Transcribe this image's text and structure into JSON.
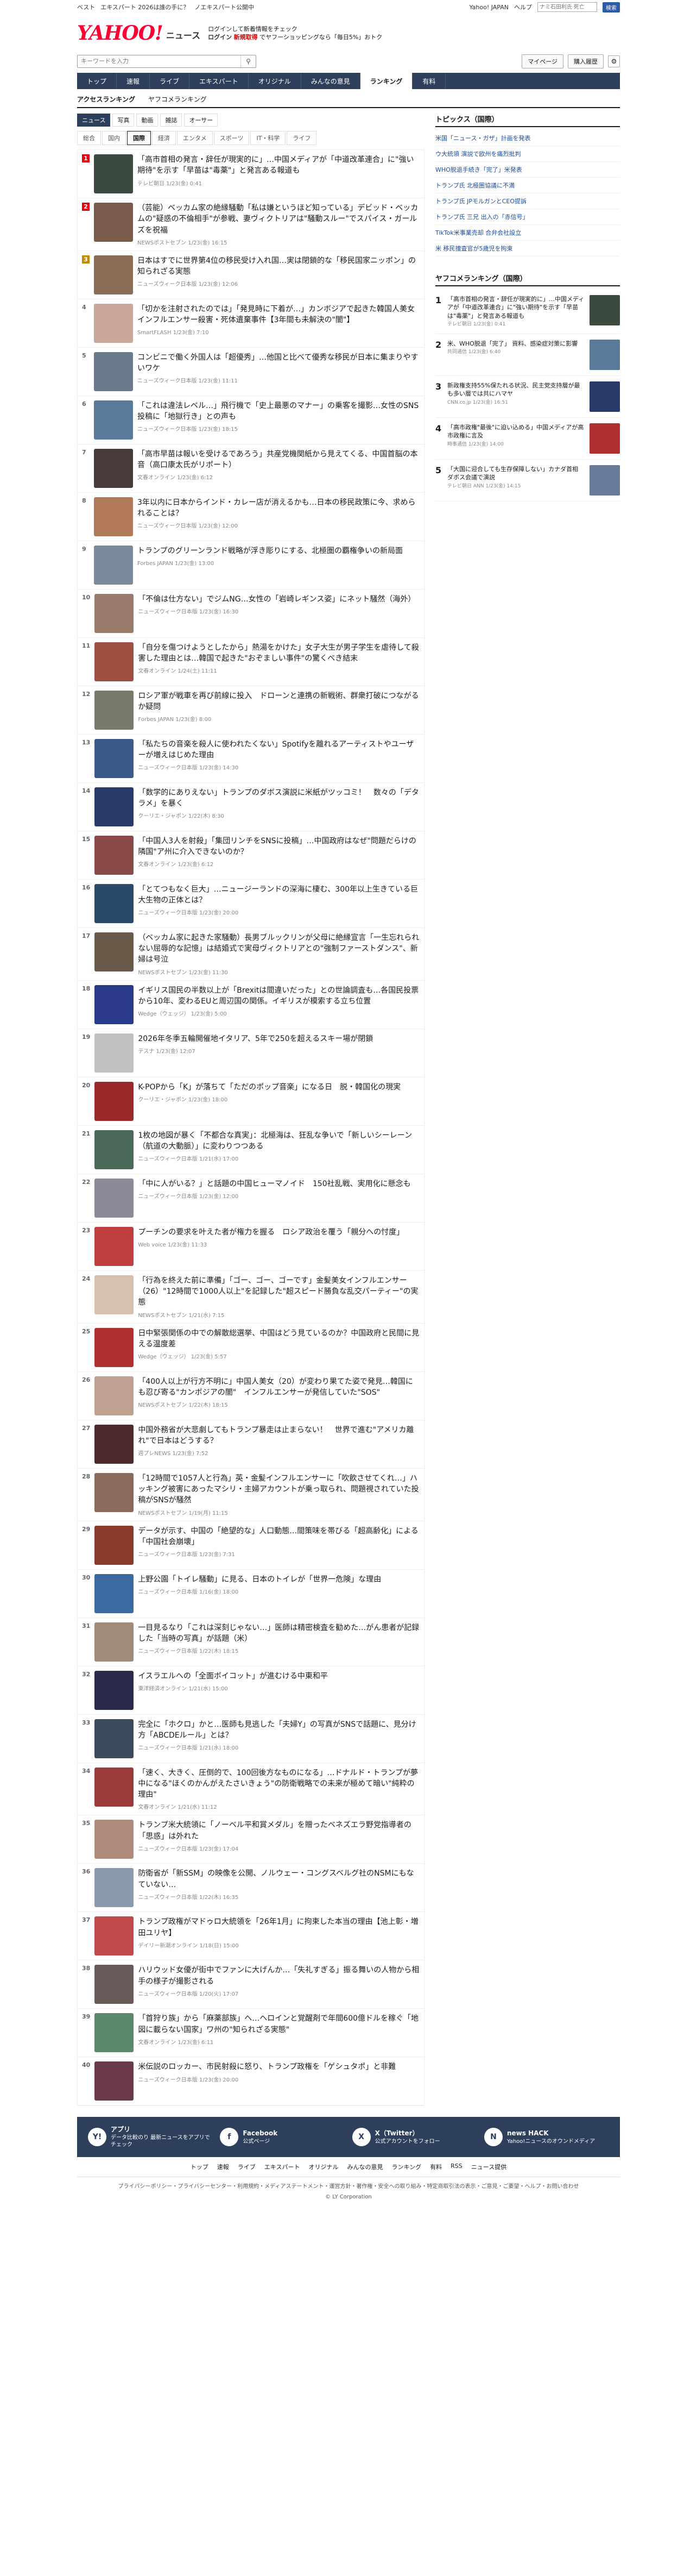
{
  "topstrip": {
    "left": [
      "ベスト",
      "エキスパート 2026は誰の手に？",
      "ノエキスパート公開中"
    ],
    "right_links": [
      "Yahoo! JAPAN",
      "ヘルプ"
    ],
    "search_placeholder": "ナミ石田利氏 死亡",
    "search_button": "検索"
  },
  "header": {
    "logo_text": "YAHOO!",
    "logo_sub": "JAPAN",
    "news_label": "ニュース",
    "promo_line1": "ログインして新着情報をチェック",
    "promo_line2": "お得なサービス",
    "login_label": "ログイン",
    "promo_red": "新規取得",
    "promo_line3": "でヤフーショッピングなら「毎日5%」おトク"
  },
  "search": {
    "placeholder": "キーワードを入力",
    "mypage": "マイページ",
    "register": "購入履歴"
  },
  "nav": [
    "トップ",
    "速報",
    "ライブ",
    "エキスパート",
    "オリジナル",
    "みんなの意見",
    "ランキング",
    "有料"
  ],
  "nav_active": 6,
  "ranking_tabs": [
    "アクセスランキング",
    "ヤフコメランキング"
  ],
  "subtabs": [
    "ニュース",
    "写真",
    "動画",
    "雑誌",
    "オーサー"
  ],
  "category_tabs": [
    "総合",
    "国内",
    "国際",
    "経済",
    "エンタメ",
    "スポーツ",
    "IT・科学",
    "ライフ"
  ],
  "category_active": 2,
  "articles": [
    {
      "rank": "1",
      "title": "「高市首相の発言・辞任が現実的に」…中国メディアが「中道改革連合」に\"強い期待\"を示す「早苗は\"毒薬\"」と発言ある報道も",
      "meta": "テレビ朝日 1/23(金) 0:41"
    },
    {
      "rank": "2",
      "title": "（芸能）ベッカム家の絶縁騒動「私は嫌というほど知っている」デビッド・ベッカムの\"疑惑の不倫相手\"が参戦、妻ヴィクトリアは\"騒動スルー\"でスパイス・ガールズを祝福",
      "meta": "NEWSポストセブン 1/23(金) 16:15"
    },
    {
      "rank": "3",
      "title": "日本はすでに世界第4位の移民受け入れ国…実は閉鎖的な「移民国家ニッポン」の知られざる実態",
      "meta": "ニューズウィーク日本版 1/23(金) 12:06"
    },
    {
      "rank": "4",
      "title": "「切かを注射されたのでは」「発見時に下着が…」カンボジアで起きた韓国人美女インフルエンサー殺害・死体遺棄事件【3年間も未解決の\"闇\"】",
      "meta": "SmartFLASH 1/23(金) 7:10"
    },
    {
      "rank": "5",
      "title": "コンビニで働く外国人は「超優秀」…他国と比べて優秀な移民が日本に集まりやすいワケ",
      "meta": "ニューズウィーク日本版 1/23(金) 11:11"
    },
    {
      "rank": "6",
      "title": "「これは違法レベル…」飛行機で「史上最悪のマナー」の乗客を撮影…女性のSNS投稿に「地獄行き」との声も",
      "meta": "ニューズウィーク日本版 1/23(金) 18:15"
    },
    {
      "rank": "7",
      "title": "「高市早苗は報いを受けるであろう」共産党機関紙から見えてくる、中国首脳の本音（高口康太氏がリポート）",
      "meta": "文春オンライン 1/23(金) 6:12"
    },
    {
      "rank": "8",
      "title": "3年以内に日本からインド・カレー店が消えるかも…日本の移民政策に今、求められることは？",
      "meta": "ニューズウィーク日本版 1/23(金) 12:00"
    },
    {
      "rank": "9",
      "title": "トランプのグリーンランド戦略が浮き彫りにする、北極圏の覇権争いの新局面",
      "meta": "Forbes JAPAN 1/23(金) 13:00"
    },
    {
      "rank": "10",
      "title": "「不倫は仕方ない」でジムNG…女性の「岩崎レギンス姿」にネット騒然（海外）",
      "meta": "ニューズウィーク日本版 1/23(金) 16:30"
    },
    {
      "rank": "11",
      "title": "「自分を傷つけようとしたから」熱湯をかけた」女子大生が男子学生を虐待して殺害した理由とは…韓国で起きた\"おぞましい事件\"の驚くべき結末",
      "meta": "文春オンライン 1/24(土) 11:11"
    },
    {
      "rank": "12",
      "title": "ロシア軍が戦車を再び前線に投入　ドローンと連携の新戦術、群衆打破につながるか疑問",
      "meta": "Forbes JAPAN 1/23(金) 8:00"
    },
    {
      "rank": "13",
      "title": "「私たちの音楽を殺人に使われたくない」Spotifyを離れるアーティストやユーザーが増えはじめた理由",
      "meta": "ニューズウィーク日本版 1/23(金) 14:30"
    },
    {
      "rank": "14",
      "title": "「数学的にありえない」トランプのダボス演説に米紙がツッコミ！　数々の「デタラメ」を暴く",
      "meta": "クーリエ・ジャポン 1/22(木) 8:30"
    },
    {
      "rank": "15",
      "title": "「中国人3人を射殺」「集団リンチをSNSに投稿」…中国政府はなぜ\"問題だらけの隣国\"ア州に介入できないのか？",
      "meta": "文春オンライン 1/23(金) 6:12"
    },
    {
      "rank": "16",
      "title": "「とてつもなく巨大」…ニュージーランドの深海に棲む、300年以上生きている巨大生物の正体とは？",
      "meta": "ニューズウィーク日本版 1/23(金) 20:00"
    },
    {
      "rank": "17",
      "title": "（ベッカム家に起きた家騒動）長男ブルックリンが父母に絶縁宣言「一生忘れられない屈辱的な記憶」は結婚式で実母ヴィクトリアとの\"強制ファーストダンス\"、新婦は号泣",
      "meta": "NEWSポストセブン 1/23(金) 11:30"
    },
    {
      "rank": "18",
      "title": "イギリス国民の半数以上が「Brexitは間違いだった」との世論調査も…各国民投票から10年、変わるEUと周辺国の関係。イギリスが模索する立ち位置",
      "meta": "Wedge（ウェッジ） 1/23(金) 5:00"
    },
    {
      "rank": "19",
      "title": "2026年冬季五輪開催地イタリア、5年で250を超えるスキー場が閉鎖",
      "meta": "テスナ 1/23(金) 12:07"
    },
    {
      "rank": "20",
      "title": "K-POPから「K」が落ちて「ただのポップ音楽」になる日　脱・韓国化の現実",
      "meta": "クーリエ・ジャポン 1/23(金) 18:00"
    },
    {
      "rank": "21",
      "title": "1枚の地図が暴く「不都合な真実」：北極海は、狂乱な争いで「新しいシーレーン（航道の大動脈）」に変わりつつある",
      "meta": "ニューズウィーク日本版 1/21(水) 17:00"
    },
    {
      "rank": "22",
      "title": "「中に人がいる？」と話題の中国ヒューマノイド　150社乱戦、実用化に懸念も",
      "meta": "ニューズウィーク日本版 1/23(金) 12:00"
    },
    {
      "rank": "23",
      "title": "プーチンの要求を叶えた者が権力を握る　ロシア政治を覆う「親分への忖度」",
      "meta": "Web voice 1/23(金) 11:33"
    },
    {
      "rank": "24",
      "title": "「行為を終えた前に準備」「ゴー、ゴー、ゴーです」金髪美女インフルエンサー（26）\"12時間で1000人以上\"を記録した\"超スピード勝負な乱交パーティー\"の実態",
      "meta": "NEWSポストセブン 1/21(水) 7:15"
    },
    {
      "rank": "25",
      "title": "日中緊張関係の中での解散総選挙、中国はどう見ているのか？中国政府と民間に見える温度差",
      "meta": "Wedge（ウェッジ） 1/23(金) 5:57"
    },
    {
      "rank": "26",
      "title": "「400人以上が行方不明に」中国人美女（20）が変わり果てた姿で発見…韓国にも忍び寄る\"カンボジアの闇\"　インフルエンサーが発信していた\"SOS\"",
      "meta": "NEWSポストセブン 1/22(木) 18:15"
    },
    {
      "rank": "27",
      "title": "中国外務省が大悲劇してもトランプ暴走は止まらない！　世界で進む\"アメリカ離れ\"で日本はどうする？",
      "meta": "週プレNEWS 1/23(金) 7:52"
    },
    {
      "rank": "28",
      "title": "「12時間で1057人と行為」英・金髪インフルエンサーに「吹飲させてくれ…」ハッキング被害にあったマシリ・主婦アカウントが乗っ取られ、問題視されていた投稿がSNSが騒然",
      "meta": "NEWSポストセブン 1/19(月) 11:15"
    },
    {
      "rank": "29",
      "title": "データが示す、中国の「絶望的な」人口動態…間策味を帯びる「超高齢化」による「中国社会崩壊」",
      "meta": "ニューズウィーク日本版 1/23(金) 7:31"
    },
    {
      "rank": "30",
      "title": "上野公園「トイレ騒動」に見る、日本のトイレが「世界一危険」な理由",
      "meta": "ニューズウィーク日本版 1/16(金) 18:00"
    },
    {
      "rank": "31",
      "title": "一目見るなり「これは深刻じゃない…」医師は精密検査を勧めた…がん患者が記録した「当時の写真」が話題（米）",
      "meta": "ニューズウィーク日本版 1/22(木) 18:15"
    },
    {
      "rank": "32",
      "title": "イスラエルへの「全面ボイコット」が進むける中東和平",
      "meta": "東洋経済オンライン 1/21(水) 15:00"
    },
    {
      "rank": "33",
      "title": "完全に「ホクロ」かと…医師も見逃した「夫婦Y」の写真がSNSで話題に、見分け方「ABCDEルール」とは？",
      "meta": "ニューズウィーク日本版 1/21(水) 18:00"
    },
    {
      "rank": "34",
      "title": "「速く、大きく、圧倒的で、100回後方なものになる」…ドナルド・トランプが夢中になる\"ほくのかんがえたさいきょう\"の防衛戦略での未来が極めて暗い\"純粋の理由\"",
      "meta": "文春オンライン 1/21(水) 11:12"
    },
    {
      "rank": "35",
      "title": "トランプ米大統領に「ノーベル平和賞メダル」を贈ったベネズエラ野党指導者の「思惑」は外れた",
      "meta": "ニューズウィーク日本版 1/23(金) 17:04"
    },
    {
      "rank": "36",
      "title": "防衛省が「新SSM」の映像を公開、ノルウェー・コングスベルグ社のNSMにもなていない…",
      "meta": "ニューズウィーク日本版 1/22(木) 16:35"
    },
    {
      "rank": "37",
      "title": "トランプ政権がマドゥロ大統領を「26年1月」に拘束した本当の理由【池上彰・増田ユリヤ】",
      "meta": "デイリー新潮オンライン 1/18(日) 15:00"
    },
    {
      "rank": "38",
      "title": "ハリウッド女優が街中でファンに大げんか…「失礼すぎる」振る舞いの人物から相手の様子が撮影される",
      "meta": "ニューズウィーク日本版 1/20(火) 17:07"
    },
    {
      "rank": "39",
      "title": "「首狩り族」から「麻薬部族」へ…ヘロインと覚醒剤で年間600億ドルを稼ぐ「地図に載らない国家」ワ州の\"知られざる実態\"",
      "meta": "文春オンライン 1/23(金) 6:11"
    },
    {
      "rank": "40",
      "title": "米伝説のロッカー、市民射殺に怒り、トランプ政権を「ゲシュタポ」と非難",
      "meta": "ニューズウィーク日本版 1/23(金) 20:00"
    }
  ],
  "thumb_colors": [
    "#3b4a3e",
    "#7a5a4a",
    "#8a6d55",
    "#c9a89a",
    "#6b7a8a",
    "#5a7a9a",
    "#4a3a3a",
    "#b07a5a",
    "#7a8a9a",
    "#9a7a6a",
    "#a05040",
    "#7a7a6a",
    "#3a5a8a",
    "#2a3a6a",
    "#8a4a4a",
    "#2a4a6a",
    "#6a5a4a",
    "#2a3a8a",
    "#c0c0c0",
    "#9a2a2a",
    "#4a6a5a",
    "#8a8a9a",
    "#c04040",
    "#d8c0b0",
    "#b03030",
    "#c0a090",
    "#4a2a2a",
    "#8a6a5a",
    "#8a3a2a",
    "#3a6aa0",
    "#a08a7a",
    "#2a2a4a",
    "#3a4a5a",
    "#9a3a3a",
    "#b08a7a",
    "#8a9aaa",
    "#c04a4a",
    "#6a5a5a",
    "#5a8a6a",
    "#6a3a4a"
  ],
  "sidebar": {
    "topics_title": "トピックス（国際）",
    "topics": [
      "米国「ニュース・ガザ」計画を発表",
      "ウ大統領 演説で欧州を痛烈批判",
      "WHO脱退手続き「完了」米発表",
      "トランプ氏 北極圏協議に不満",
      "トランプ氏 JPモルガンとCEO提訴",
      "トランプ氏 三兄 出入の「赤信号」",
      "TikTok米事業売却 合弁会社設立",
      "米 移民捜査官が5歳児を拘束"
    ],
    "ranking_title": "ヤフコメランキング（国際）",
    "ranking": [
      {
        "n": "1",
        "title": "「高市首相の発言・辞任が現実的に」…中国メディアが「中道改革連合」に\"強い期待\"を示す「早苗は\"毒薬\"」と発言ある報道も",
        "meta": "テレビ朝日 1/23(金) 0:41",
        "color": "#3b4a3e"
      },
      {
        "n": "2",
        "title": "米、WHO脱退「完了」 資料、感染症対策に影響",
        "meta": "共同通信 1/23(金) 6:40",
        "color": "#5a7a9a"
      },
      {
        "n": "3",
        "title": "新政権支持55%保たれる状況、民主党支持層が最も多い層では共にハマヤ",
        "meta": "CNN.co.jp 1/23(金) 16:51",
        "color": "#2a3a6a"
      },
      {
        "n": "4",
        "title": "「高市政権\"最後\"に迫い込める」中国メディアが高市政権に言及",
        "meta": "時事通信 1/23(金) 14:00",
        "color": "#b03030"
      },
      {
        "n": "5",
        "title": "「大国に迎合しても生存保障しない」カナダ首相 ダボス会議で演説",
        "meta": "テレビ朝日 ANN 1/23(金) 14:15",
        "color": "#6a7a9a"
      }
    ]
  },
  "footer": {
    "cols": [
      {
        "icon": "Y!",
        "head": "アプリ",
        "text": "データ比較のり 最新ニュースをアプリでチェック"
      },
      {
        "icon": "f",
        "head": "Facebook",
        "text": "公式ページ"
      },
      {
        "icon": "X",
        "head": "X（Twitter）",
        "text": "公式アカウントをフォロー"
      },
      {
        "icon": "N",
        "head": "news HACK",
        "text": "Yahoo!ニュースのオウンドメディア"
      }
    ],
    "nav": [
      "トップ",
      "速報",
      "ライブ",
      "エキスパート",
      "オリジナル",
      "みんなの意見",
      "ランキング",
      "有料",
      "RSS",
      "ニュース提供"
    ],
    "legal": "プライバシーポリシー・プライバシーセンター・利用規約・メディアステートメント・運営方針・著作権・安全への取り組み・特定商取引法の表示・ご意見・ご要望・ヘルプ・お問い合わせ",
    "copyright": "© LY Corporation"
  }
}
